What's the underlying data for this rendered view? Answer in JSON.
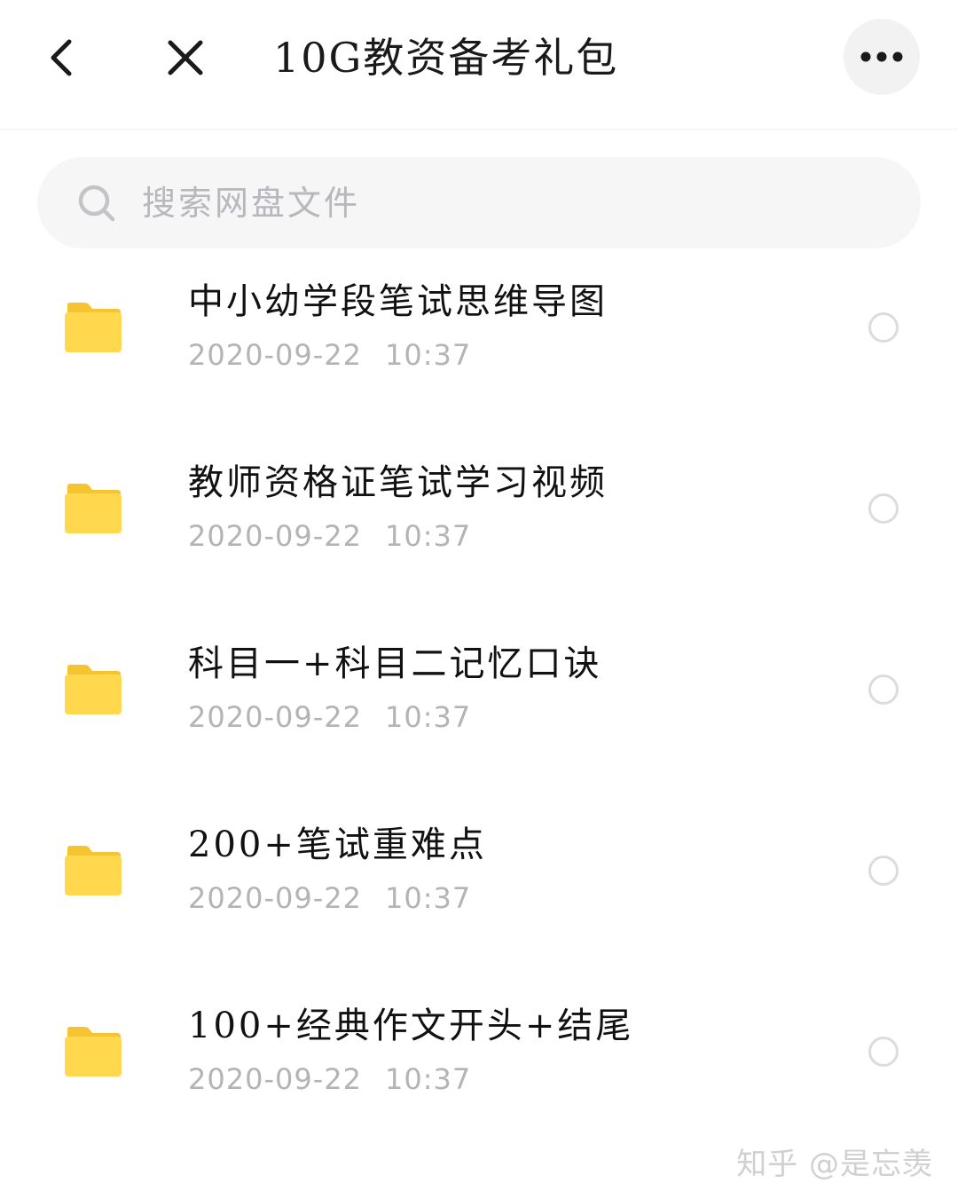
{
  "header": {
    "title": "10G教资备考礼包"
  },
  "search": {
    "placeholder": "搜索网盘文件",
    "value": ""
  },
  "files": [
    {
      "name": "中小幼学段笔试思维导图",
      "date": "2020-09-22",
      "time": "10:37"
    },
    {
      "name": "教师资格证笔试学习视频",
      "date": "2020-09-22",
      "time": "10:37"
    },
    {
      "name": "科目一+科目二记忆口诀",
      "date": "2020-09-22",
      "time": "10:37"
    },
    {
      "name": "200+笔试重难点",
      "date": "2020-09-22",
      "time": "10:37"
    },
    {
      "name": "100+经典作文开头+结尾",
      "date": "2020-09-22",
      "time": "10:37"
    }
  ],
  "watermark": "知乎 @是忘羡",
  "colors": {
    "folder": "#FFD84D",
    "folder_tab": "#F7C431",
    "date_text": "#B3B3B8",
    "radio_border": "#DCDCDC"
  },
  "icons": {
    "back": "chevron-left-icon",
    "close": "close-icon",
    "more": "more-horizontal-icon",
    "search": "search-icon",
    "folder": "folder-icon"
  }
}
